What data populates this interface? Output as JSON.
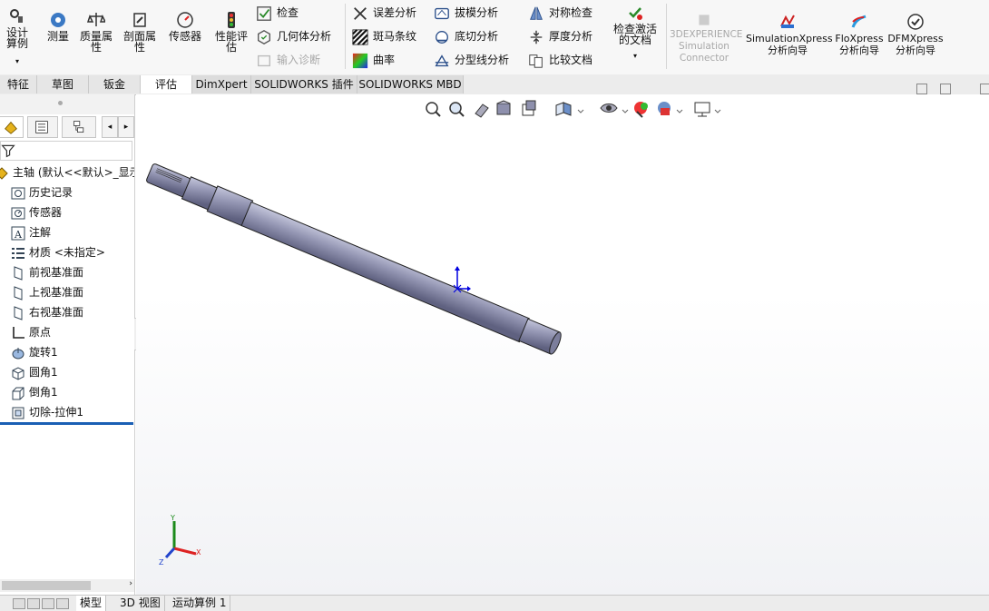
{
  "ribbon": {
    "design_study": "设计算例",
    "measure": "测量",
    "mass_props": "质量属性",
    "section_props": "剖面属性",
    "sensors": "传感器",
    "performance": "性能评估",
    "check": "检查",
    "geometry_analysis": "几何体分析",
    "import_diagnostics": "输入诊断",
    "deviation": "误差分析",
    "zebra": "斑马条纹",
    "curvature": "曲率",
    "draft": "拔模分析",
    "undercut": "底切分析",
    "parting_line": "分型线分析",
    "symmetry": "对称检查",
    "thickness": "厚度分析",
    "compare": "比较文档",
    "check_active": "检查激活的文档",
    "experience": "3DEXPERIENCE Simulation Connector",
    "simxpress": "SimulationXpress 分析向导",
    "floxpress": "FloXpress 分析向导",
    "dfmxpress": "DFMXpress 分析向导"
  },
  "tabs": [
    "特征",
    "草图",
    "钣金",
    "评估",
    "DimXpert",
    "SOLIDWORKS 插件",
    "SOLIDWORKS MBD"
  ],
  "tree": {
    "root": "主轴 (默认<<默认>_显示",
    "items": [
      "历史记录",
      "传感器",
      "注解",
      "材质 <未指定>",
      "前视基准面",
      "上视基准面",
      "右视基准面",
      "原点",
      "旋转1",
      "圆角1",
      "倒角1",
      "切除-拉伸1"
    ]
  },
  "bottom_tabs": [
    "模型",
    "3D 视图",
    "运动算例 1"
  ],
  "triad": {
    "x": "X",
    "y": "Y",
    "z": "Z"
  },
  "colors": {
    "accent": "#1a5fb4",
    "shaft": "#8e90ad"
  }
}
